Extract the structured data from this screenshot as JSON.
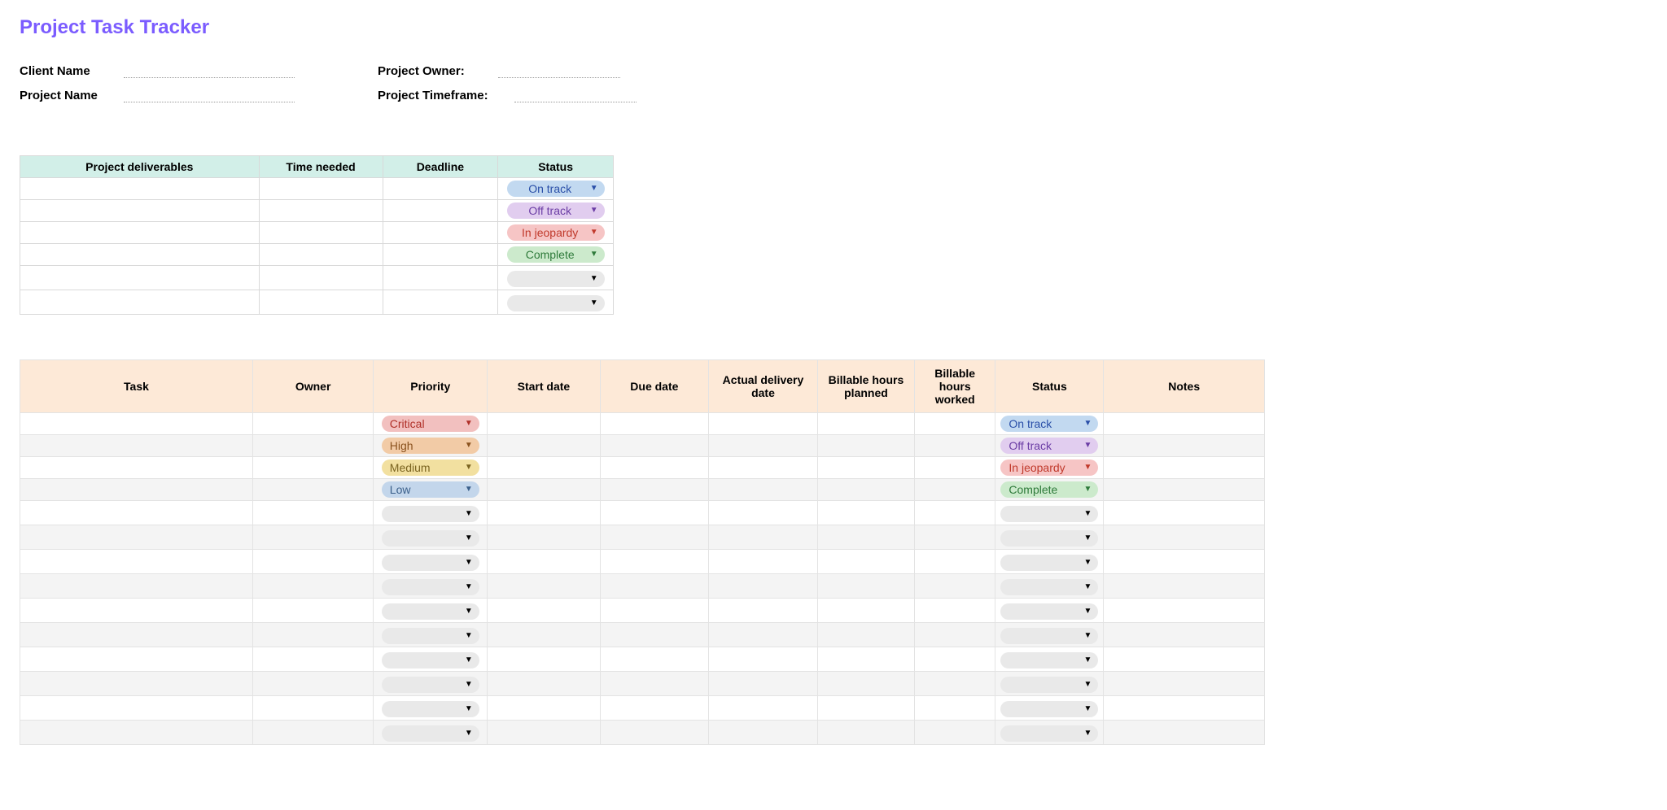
{
  "title": "Project Task Tracker",
  "meta": {
    "client_name_label": "Client Name",
    "project_name_label": "Project Name",
    "project_owner_label": "Project Owner:",
    "project_timeframe_label": "Project Timeframe:"
  },
  "status_labels": {
    "on_track": "On track",
    "off_track": "Off track",
    "in_jeopardy": "In jeopardy",
    "complete": "Complete"
  },
  "priority_labels": {
    "critical": "Critical",
    "high": "High",
    "medium": "Medium",
    "low": "Low"
  },
  "deliverables_table": {
    "headers": {
      "project_deliverables": "Project deliverables",
      "time_needed": "Time needed",
      "deadline": "Deadline",
      "status": "Status"
    },
    "rows": [
      {
        "status": "on_track"
      },
      {
        "status": "off_track"
      },
      {
        "status": "in_jeopardy"
      },
      {
        "status": "complete"
      },
      {
        "status": ""
      },
      {
        "status": ""
      }
    ]
  },
  "tasks_table": {
    "headers": {
      "task": "Task",
      "owner": "Owner",
      "priority": "Priority",
      "start_date": "Start date",
      "due_date": "Due date",
      "actual_delivery_date": "Actual delivery date",
      "billable_hours_planned": "Billable hours planned",
      "billable_hours_worked": "Billable hours worked",
      "status": "Status",
      "notes": "Notes"
    },
    "rows": [
      {
        "priority": "critical",
        "status": "on_track"
      },
      {
        "priority": "high",
        "status": "off_track"
      },
      {
        "priority": "medium",
        "status": "in_jeopardy"
      },
      {
        "priority": "low",
        "status": "complete"
      },
      {
        "priority": "",
        "status": ""
      },
      {
        "priority": "",
        "status": ""
      },
      {
        "priority": "",
        "status": ""
      },
      {
        "priority": "",
        "status": ""
      },
      {
        "priority": "",
        "status": ""
      },
      {
        "priority": "",
        "status": ""
      },
      {
        "priority": "",
        "status": ""
      },
      {
        "priority": "",
        "status": ""
      },
      {
        "priority": "",
        "status": ""
      },
      {
        "priority": "",
        "status": ""
      }
    ]
  }
}
